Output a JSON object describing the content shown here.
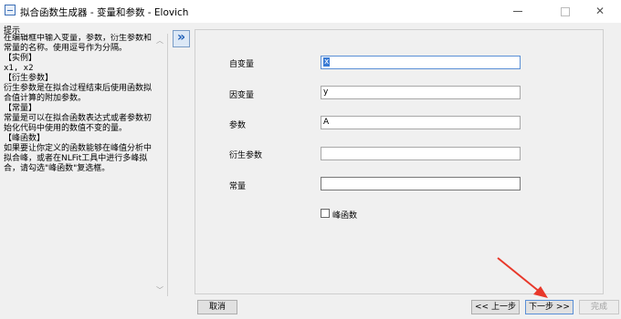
{
  "window": {
    "title": "拟合函数生成器 - 变量和参数 - Elovich"
  },
  "hint": {
    "header": "提示",
    "intro": "在编辑框中输入变量，参数，衍生参数和常量的名称。使用逗号作为分隔。",
    "example_title": "【实例】",
    "example_text": "x1, x2",
    "derived_title": "【衍生参数】",
    "derived_text": "衍生参数是在拟合过程结束后使用函数拟合值计算的附加参数。",
    "const_title": "【常量】",
    "const_text": "常量是可以在拟合函数表达式或者参数初始化代码中使用的数值不变的量。",
    "peak_title": "【峰函数】",
    "peak_text": "如果要让你定义的函数能够在峰值分析中拟合峰，或者在NLFit工具中进行多峰拟合，请勾选\"峰函数\"复选框。"
  },
  "form": {
    "fields": [
      {
        "label": "自变量",
        "value": "x"
      },
      {
        "label": "因变量",
        "value": "y"
      },
      {
        "label": "参数",
        "value": "A"
      },
      {
        "label": "衍生参数",
        "value": ""
      },
      {
        "label": "常量",
        "value": ""
      }
    ],
    "peak_checkbox": {
      "label": "峰函数",
      "checked": false
    }
  },
  "buttons": {
    "cancel": "取消",
    "prev": "<< 上一步",
    "next": "下一步 >>",
    "finish": "完成"
  },
  "colors": {
    "accent": "#3a7bd5",
    "arrow": "#e8382a"
  }
}
